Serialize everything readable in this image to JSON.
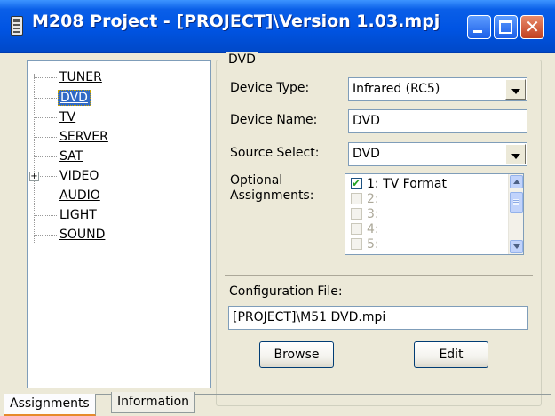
{
  "window": {
    "title": "M208 Project - [PROJECT]\\Version 1.03.mpj",
    "close_glyph": "✕"
  },
  "tree": {
    "items": [
      {
        "label": "TUNER"
      },
      {
        "label": "DVD"
      },
      {
        "label": "TV"
      },
      {
        "label": "SERVER"
      },
      {
        "label": "SAT"
      },
      {
        "label": "VIDEO",
        "expander": "+"
      },
      {
        "label": "AUDIO"
      },
      {
        "label": "LIGHT"
      },
      {
        "label": "SOUND"
      }
    ],
    "selected": "DVD"
  },
  "panel": {
    "group_title": "DVD",
    "device_type": {
      "label": "Device Type:",
      "value": "Infrared (RC5)"
    },
    "device_name": {
      "label": "Device Name:",
      "value": "DVD"
    },
    "source_select": {
      "label": "Source Select:",
      "value": "DVD"
    },
    "optional_assignments": {
      "label_line1": "Optional",
      "label_line2": "Assignments:",
      "items": [
        {
          "text": "1: TV Format",
          "checked": true,
          "enabled": true
        },
        {
          "text": "2:",
          "checked": false,
          "enabled": false
        },
        {
          "text": "3:",
          "checked": false,
          "enabled": false
        },
        {
          "text": "4:",
          "checked": false,
          "enabled": false
        },
        {
          "text": "5:",
          "checked": false,
          "enabled": false
        }
      ]
    },
    "config_file": {
      "label": "Configuration File:",
      "value": "[PROJECT]\\M51 DVD.mpi"
    },
    "browse_label": "Browse",
    "edit_label": "Edit"
  },
  "tabs": [
    {
      "label": "Assignments",
      "active": true
    },
    {
      "label": "Information",
      "active": false
    }
  ],
  "colors": {
    "selection": "#316ac5",
    "titlebar": "#0054e3",
    "window_bg": "#ece9d8"
  }
}
